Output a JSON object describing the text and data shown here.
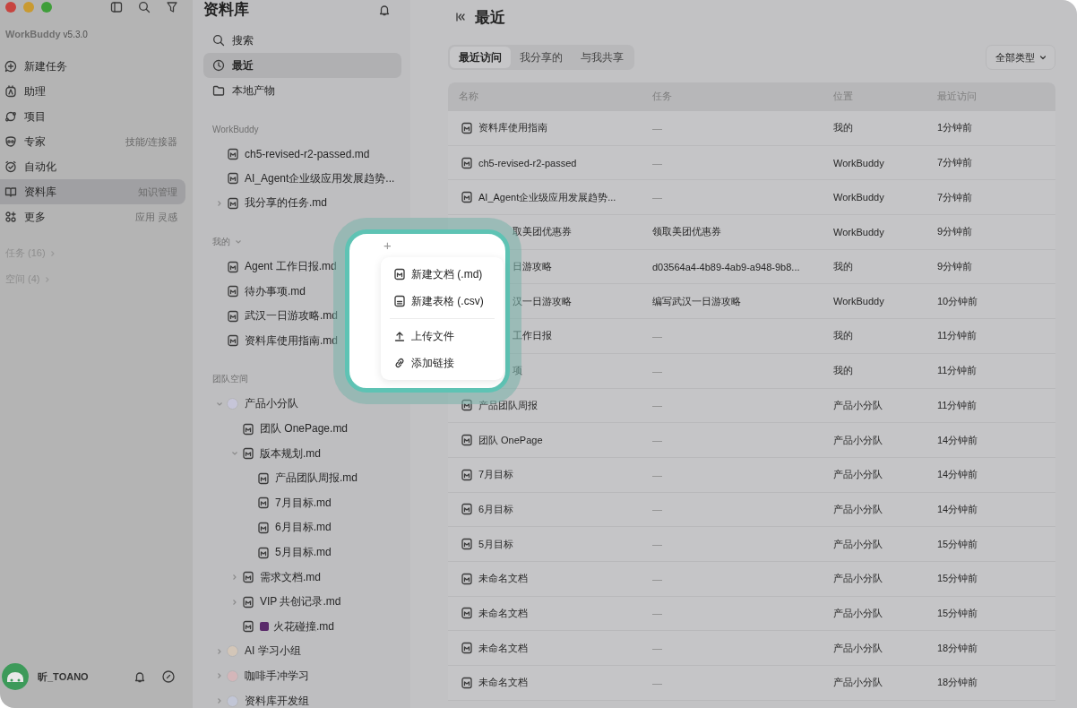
{
  "sidebar": {
    "app_name": "WorkBuddy",
    "version": "v5.3.0",
    "nav": [
      {
        "kind": "new-task",
        "label": "新建任务",
        "selected": false
      },
      {
        "kind": "assistant",
        "label": "助理",
        "selected": false
      },
      {
        "kind": "project",
        "label": "项目",
        "selected": false
      },
      {
        "kind": "expert",
        "label": "专家",
        "hint": "技能/连接器",
        "selected": false
      },
      {
        "kind": "automation",
        "label": "自动化",
        "selected": false
      },
      {
        "kind": "library",
        "label": "资料库",
        "hint": "知识管理",
        "selected": true
      },
      {
        "kind": "more",
        "label": "更多",
        "hint": "应用 灵感",
        "selected": false
      }
    ],
    "sections": [
      {
        "label": "任务 (16)"
      },
      {
        "label": "空间 (4)"
      }
    ],
    "user": {
      "name": "昕_TOANO"
    }
  },
  "library": {
    "title": "资料库",
    "nav": [
      {
        "kind": "search",
        "label": "搜索",
        "selected": false
      },
      {
        "kind": "recent",
        "label": "最近",
        "selected": true
      },
      {
        "kind": "folder",
        "label": "本地产物",
        "selected": false
      }
    ],
    "groups": [
      {
        "title": "WorkBuddy",
        "items": [
          {
            "kind": "file",
            "label": "ch5-revised-r2-passed.md"
          },
          {
            "kind": "file",
            "label": "AI_Agent企业级应用发展趋势..."
          },
          {
            "kind": "file",
            "label": "我分享的任务.md",
            "expanded": false
          }
        ]
      },
      {
        "title": "我的",
        "expanded": true,
        "items": [
          {
            "kind": "file",
            "label": "Agent 工作日报.md"
          },
          {
            "kind": "file",
            "label": "待办事项.md"
          },
          {
            "kind": "file",
            "label": "武汉一日游攻略.md"
          },
          {
            "kind": "file",
            "label": "资料库使用指南.md"
          }
        ]
      },
      {
        "title": "团队空间",
        "items": [
          {
            "kind": "group",
            "label": "产品小分队",
            "color": "#c6c5d8",
            "expanded": true,
            "children": [
              {
                "kind": "file",
                "label": "团队 OnePage.md"
              },
              {
                "kind": "file",
                "label": "版本规划.md",
                "expanded": true,
                "children": [
                  {
                    "kind": "file",
                    "label": "产品团队周报.md"
                  },
                  {
                    "kind": "file",
                    "label": "7月目标.md"
                  },
                  {
                    "kind": "file",
                    "label": "6月目标.md"
                  },
                  {
                    "kind": "file",
                    "label": "5月目标.md"
                  }
                ]
              },
              {
                "kind": "file",
                "label": "需求文档.md",
                "expanded": false
              },
              {
                "kind": "file",
                "label": "VIP 共创记录.md",
                "expanded": false
              },
              {
                "kind": "spark",
                "label": "火花碰撞.md"
              }
            ]
          },
          {
            "kind": "group",
            "label": "AI 学习小组",
            "color": "#d3c6b8",
            "expanded": false
          },
          {
            "kind": "group",
            "label": "咖啡手冲学习",
            "color": "#d4b6b9",
            "expanded": false
          },
          {
            "kind": "group",
            "label": "资料库开发组",
            "color": "#c2c6d6",
            "expanded": false
          }
        ]
      }
    ]
  },
  "main": {
    "title": "最近",
    "tabs": [
      {
        "label": "最近访问",
        "selected": true
      },
      {
        "label": "我分享的",
        "selected": false
      },
      {
        "label": "与我共享",
        "selected": false
      }
    ],
    "filter": "全部类型",
    "table": {
      "columns": [
        "名称",
        "任务",
        "位置",
        "最近访问"
      ],
      "rows": [
        {
          "kind": "file",
          "name": "资料库使用指南",
          "task": "—",
          "location": "我的",
          "time": "1分钟前"
        },
        {
          "kind": "file",
          "name": "ch5-revised-r2-passed",
          "task": "—",
          "location": "WorkBuddy",
          "time": "7分钟前"
        },
        {
          "kind": "file",
          "name": "AI_Agent企业级应用发展趋势...",
          "task": "—",
          "location": "WorkBuddy",
          "time": "7分钟前"
        },
        {
          "kind": "partial",
          "name": "取美团优惠券",
          "task": "领取美团优惠券",
          "location": "WorkBuddy",
          "time": "9分钟前"
        },
        {
          "kind": "partial",
          "name": "日游攻略",
          "task": "d03564a4-4b89-4ab9-a948-9b8...",
          "location": "我的",
          "time": "9分钟前"
        },
        {
          "kind": "partial",
          "name": "汉一日游攻略",
          "task": "编写武汉一日游攻略",
          "location": "WorkBuddy",
          "time": "10分钟前"
        },
        {
          "kind": "partial",
          "name": "工作日报",
          "task": "—",
          "location": "我的",
          "time": "11分钟前"
        },
        {
          "kind": "partial",
          "name": "项",
          "task": "—",
          "location": "我的",
          "time": "11分钟前"
        },
        {
          "kind": "file",
          "name": "产品团队周报",
          "task": "—",
          "location": "产品小分队",
          "time": "11分钟前"
        },
        {
          "kind": "file",
          "name": "团队 OnePage",
          "task": "—",
          "location": "产品小分队",
          "time": "14分钟前"
        },
        {
          "kind": "file",
          "name": "7月目标",
          "task": "—",
          "location": "产品小分队",
          "time": "14分钟前"
        },
        {
          "kind": "file",
          "name": "6月目标",
          "task": "—",
          "location": "产品小分队",
          "time": "14分钟前"
        },
        {
          "kind": "file",
          "name": "5月目标",
          "task": "—",
          "location": "产品小分队",
          "time": "15分钟前"
        },
        {
          "kind": "file",
          "name": "未命名文档",
          "task": "—",
          "location": "产品小分队",
          "time": "15分钟前"
        },
        {
          "kind": "file",
          "name": "未命名文档",
          "task": "—",
          "location": "产品小分队",
          "time": "15分钟前"
        },
        {
          "kind": "file",
          "name": "未命名文档",
          "task": "—",
          "location": "产品小分队",
          "time": "18分钟前"
        },
        {
          "kind": "file",
          "name": "未命名文档",
          "task": "—",
          "location": "产品小分队",
          "time": "18分钟前"
        }
      ]
    }
  },
  "popup": {
    "add": "+",
    "groups": [
      [
        {
          "kind": "md",
          "label": "新建文档 (.md)"
        },
        {
          "kind": "csv",
          "label": "新建表格 (.csv)"
        }
      ],
      [
        {
          "kind": "upload",
          "label": "上传文件"
        },
        {
          "kind": "link",
          "label": "添加链接"
        }
      ]
    ]
  }
}
